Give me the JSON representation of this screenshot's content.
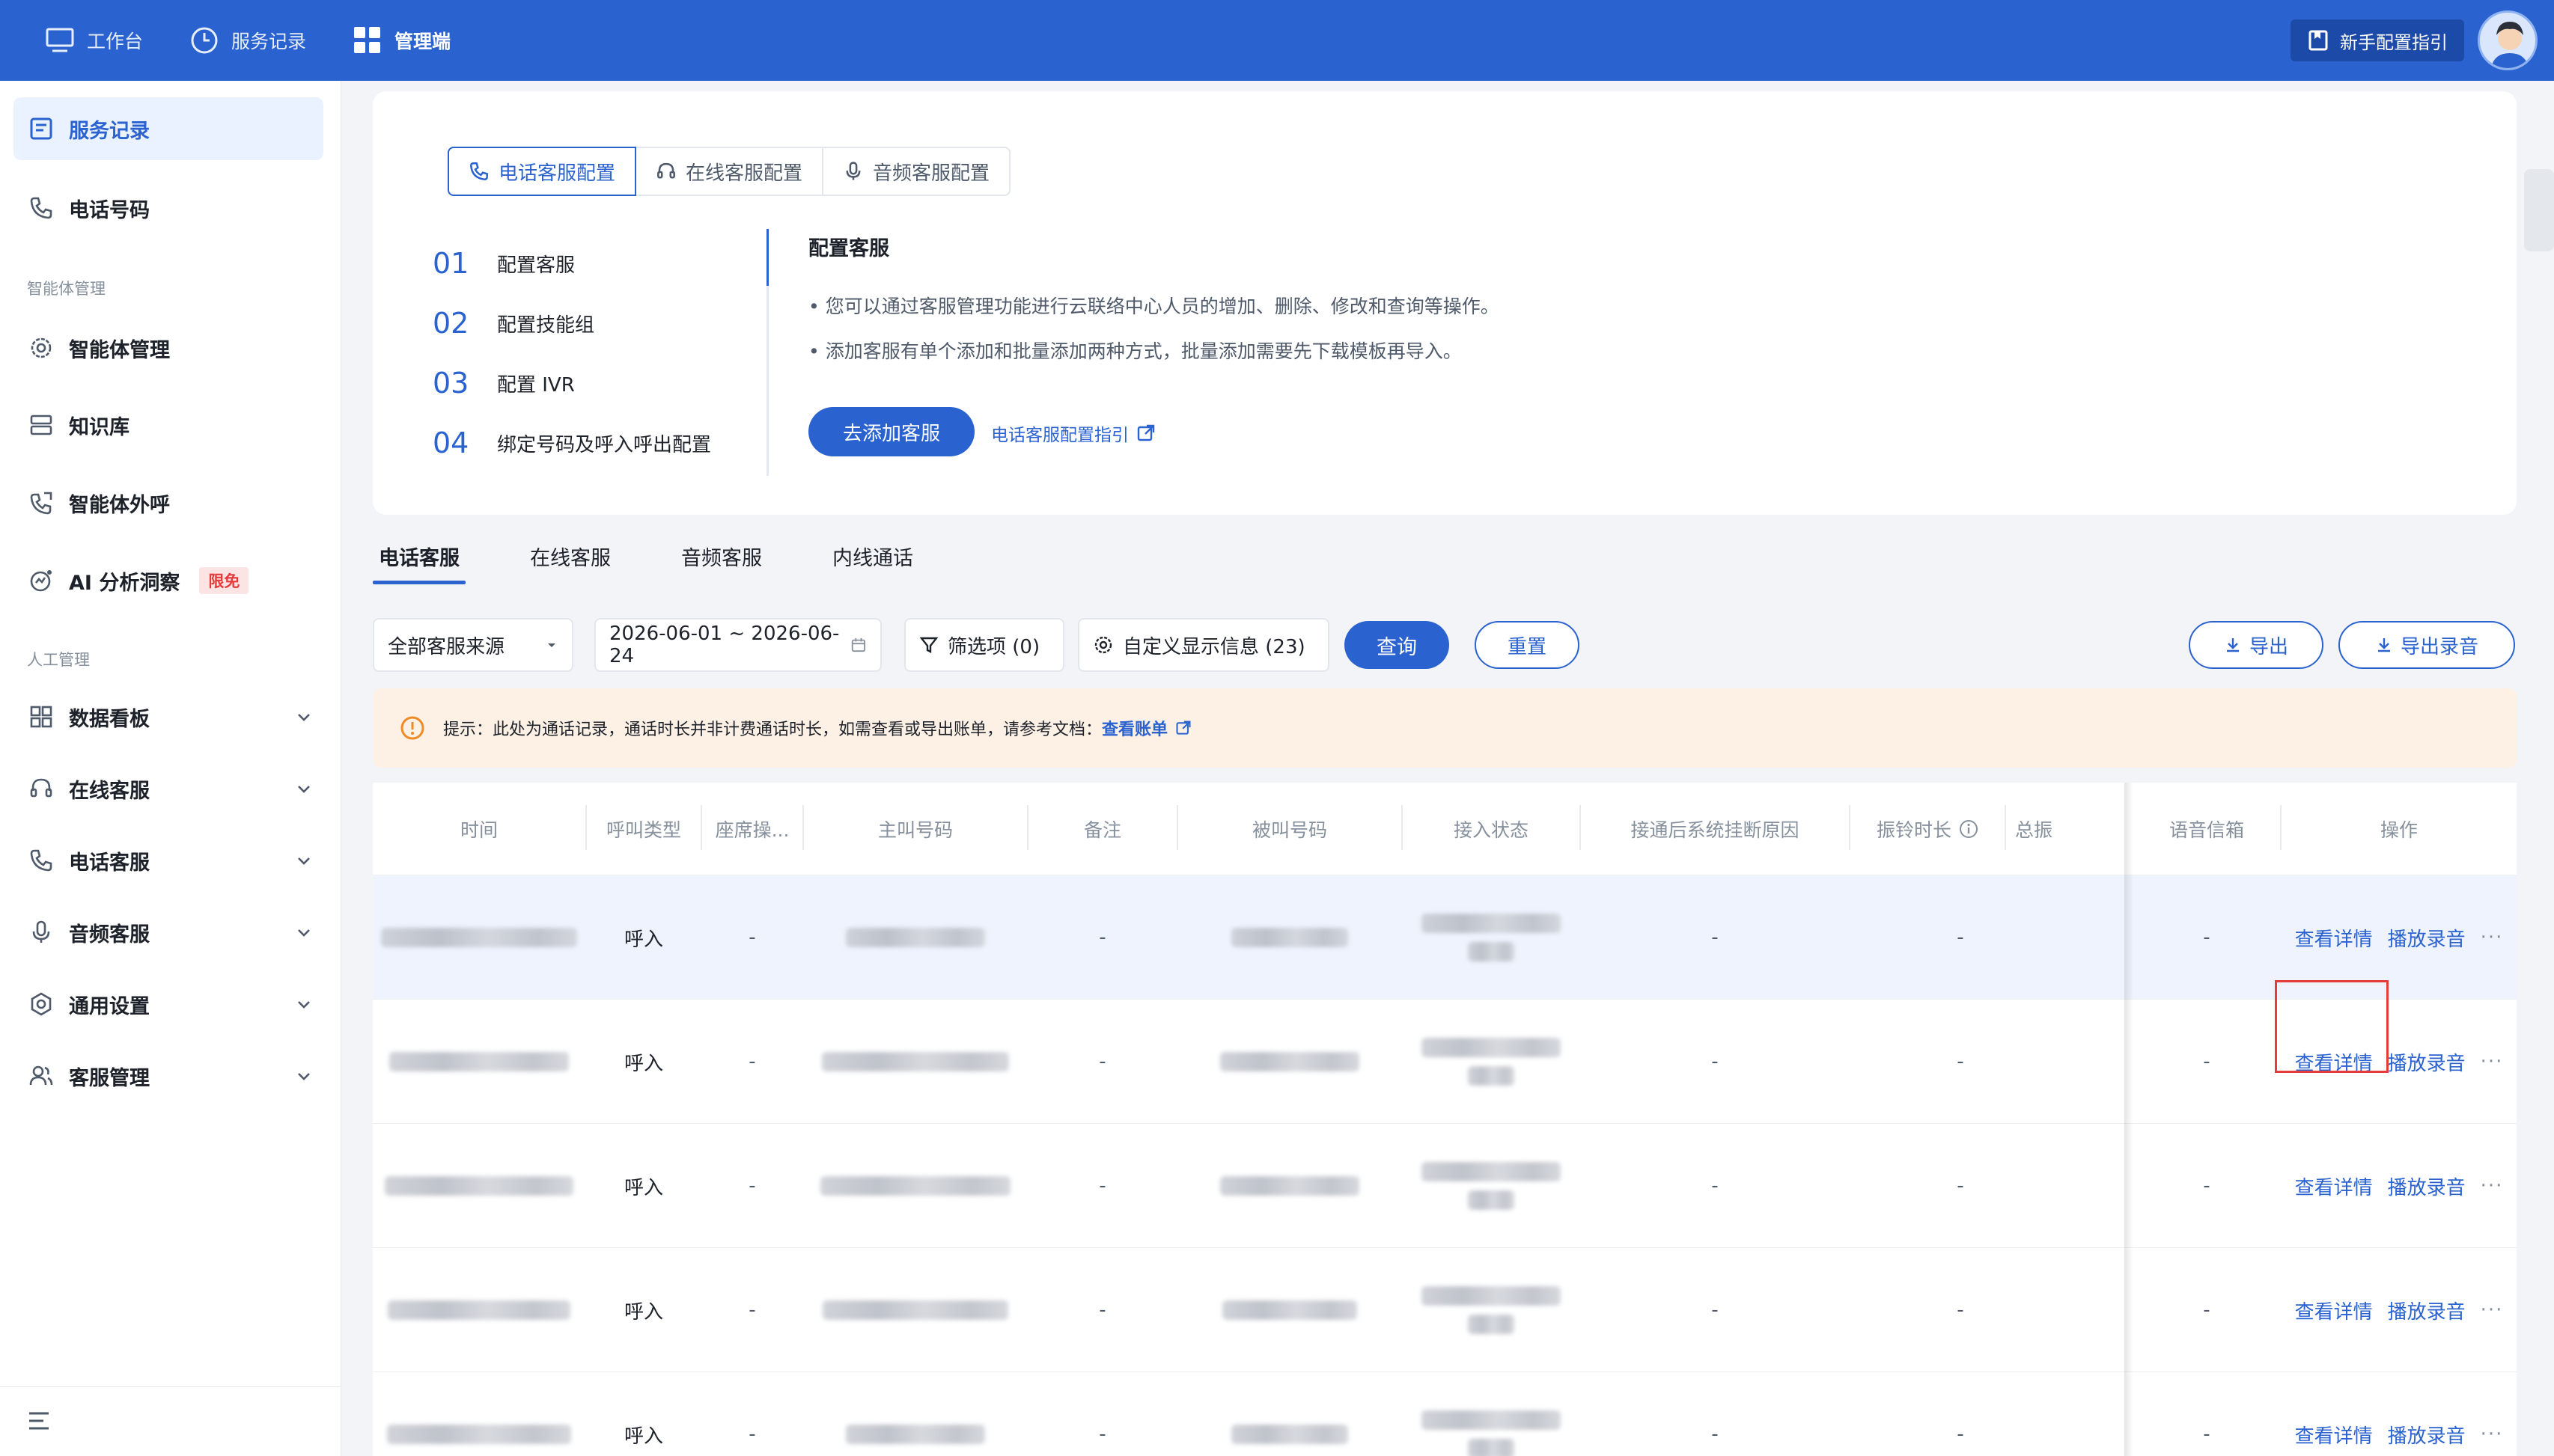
{
  "topbar": {
    "nav": [
      {
        "label": "工作台",
        "icon": "monitor-icon"
      },
      {
        "label": "服务记录",
        "icon": "clock-icon"
      },
      {
        "label": "管理端",
        "icon": "grid-icon"
      }
    ],
    "guide_label": "新手配置指引"
  },
  "sidebar": {
    "items_top": [
      {
        "label": "服务记录",
        "icon": "record-icon"
      },
      {
        "label": "电话号码",
        "icon": "phone-icon"
      }
    ],
    "group_agent": "智能体管理",
    "items_agent": [
      {
        "label": "智能体管理",
        "icon": "gear-icon"
      },
      {
        "label": "知识库",
        "icon": "database-icon"
      },
      {
        "label": "智能体外呼",
        "icon": "phone-out-icon"
      },
      {
        "label": "AI 分析洞察",
        "icon": "ai-chart-icon",
        "badge": "限免"
      }
    ],
    "group_human": "人工管理",
    "items_human": [
      {
        "label": "数据看板",
        "icon": "dashboard-icon"
      },
      {
        "label": "在线客服",
        "icon": "headset-icon"
      },
      {
        "label": "电话客服",
        "icon": "phone-icon"
      },
      {
        "label": "音频客服",
        "icon": "mic-icon"
      },
      {
        "label": "通用设置",
        "icon": "settings-icon"
      },
      {
        "label": "客服管理",
        "icon": "users-icon"
      }
    ]
  },
  "config": {
    "segments": [
      "电话客服配置",
      "在线客服配置",
      "音频客服配置"
    ],
    "steps": [
      {
        "num": "01",
        "label": "配置客服"
      },
      {
        "num": "02",
        "label": "配置技能组"
      },
      {
        "num": "03",
        "label": "配置 IVR"
      },
      {
        "num": "04",
        "label": "绑定号码及呼入呼出配置"
      }
    ],
    "title": "配置客服",
    "line1": "• 您可以通过客服管理功能进行云联络中心人员的增加、删除、修改和查询等操作。",
    "line2": "• 添加客服有单个添加和批量添加两种方式，批量添加需要先下载模板再导入。",
    "add_button": "去添加客服",
    "guide_link": "电话客服配置指引"
  },
  "tabs": [
    "电话客服",
    "在线客服",
    "音频客服",
    "内线通话"
  ],
  "filters": {
    "source": "全部客服来源",
    "date_range": "2026-06-01 ~ 2026-06-24",
    "filter_label": "筛选项 (0)",
    "custom_label": "自定义显示信息 (23)",
    "query": "查询",
    "reset": "重置",
    "export": "导出",
    "export_recording": "导出录音"
  },
  "notice": {
    "text": "提示：此处为通话记录，通话时长并非计费通话时长，如需查看或导出账单，请参考文档：",
    "link": "查看账单"
  },
  "table": {
    "columns": [
      "时间",
      "呼叫类型",
      "座席操...",
      "主叫号码",
      "备注",
      "被叫号码",
      "接入状态",
      "接通后系统挂断原因",
      "振铃时长",
      "总振",
      "语音信箱",
      "操作"
    ],
    "rows": [
      {
        "call_type": "呼入",
        "seat": "-",
        "note": "-",
        "reason": "-",
        "ring": "-",
        "voicemail": "-",
        "detail": "查看详情",
        "play": "播放录音",
        "more": "···"
      },
      {
        "call_type": "呼入",
        "seat": "-",
        "note": "-",
        "reason": "-",
        "ring": "-",
        "voicemail": "-",
        "detail": "查看详情",
        "play": "播放录音",
        "more": "···"
      },
      {
        "call_type": "呼入",
        "seat": "-",
        "note": "-",
        "reason": "-",
        "ring": "-",
        "voicemail": "-",
        "detail": "查看详情",
        "play": "播放录音",
        "more": "···"
      },
      {
        "call_type": "呼入",
        "seat": "-",
        "note": "-",
        "reason": "-",
        "ring": "-",
        "voicemail": "-",
        "detail": "查看详情",
        "play": "播放录音",
        "more": "···"
      },
      {
        "call_type": "呼入",
        "seat": "-",
        "note": "-",
        "reason": "-",
        "ring": "-",
        "voicemail": "-",
        "detail": "查看详情",
        "play": "播放录音",
        "more": "···"
      }
    ]
  },
  "colors": {
    "primary": "#2a62cf",
    "highlight_box": "#e53b3b",
    "notice_bg": "#fdf1e6"
  }
}
